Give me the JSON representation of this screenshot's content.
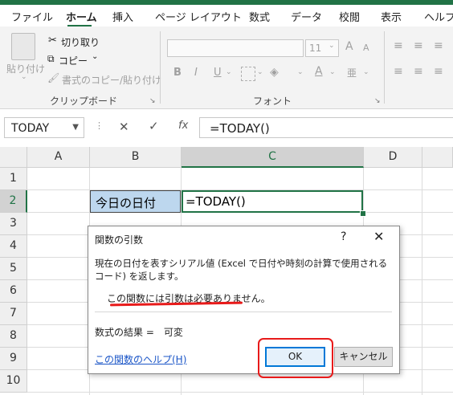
{
  "ribbon_tabs": [
    "ファイル",
    "ホーム",
    "挿入",
    "ページ レイアウト",
    "数式",
    "データ",
    "校閲",
    "表示",
    "ヘルプ"
  ],
  "clipboard": {
    "paste": "貼り付け",
    "cut": "切り取り",
    "copy": "コピー",
    "format_painter": "書式のコピー/貼り付け",
    "group_label": "クリップボード"
  },
  "font_group": {
    "size": "11",
    "bold": "B",
    "italic": "I",
    "underline": "U",
    "font_color": "A",
    "grow": "A",
    "shrink": "A",
    "group_label": "フォント"
  },
  "formula_bar": {
    "name_box": "TODAY",
    "cancel": "✕",
    "enter": "✓",
    "fx": "fx",
    "formula": "=TODAY()"
  },
  "grid": {
    "columns": [
      "A",
      "B",
      "C",
      "D"
    ],
    "rows": [
      "1",
      "2",
      "3",
      "4",
      "5",
      "6",
      "7",
      "8",
      "9",
      "10"
    ],
    "b2": "今日の日付",
    "c2": "=TODAY()"
  },
  "dialog": {
    "title": "関数の引数",
    "help": "?",
    "close": "✕",
    "description": "現在の日付を表すシリアル値 (Excel で日付や時刻の計算で使用されるコード) を返します。",
    "no_args": "この関数には引数は必要ありません。",
    "result": "数式の結果 =　可変",
    "help_link": "この関数のヘルプ(H)",
    "ok": "OK",
    "cancel": "キャンセル"
  },
  "colors": {
    "excel_green": "#217346",
    "highlight_red": "#e81a1a",
    "cell_fill": "#bdd7ee"
  }
}
